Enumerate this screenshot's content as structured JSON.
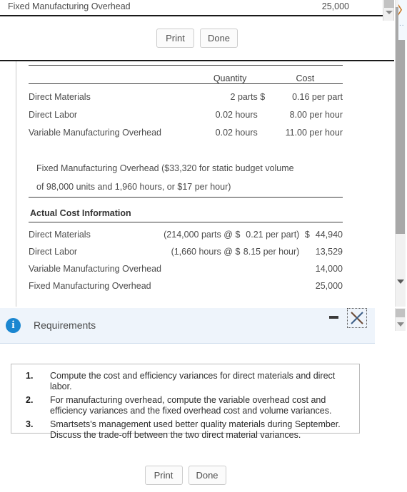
{
  "top_row": {
    "label": "Fixed Manufacturing Overhead",
    "value": "25,000"
  },
  "top_buttons": {
    "print_label": "Print",
    "done_label": "Done"
  },
  "standards_table": {
    "headers": [
      "",
      "Quantity",
      "",
      "Cost"
    ],
    "rows": [
      {
        "label": "Direct Materials",
        "quantity": "2 parts",
        "dollar": "$",
        "cost": "0.16 per part"
      },
      {
        "label": "Direct Labor",
        "quantity": "0.02 hours",
        "dollar": "",
        "cost": "8.00 per hour"
      },
      {
        "label": "Variable Manufacturing Overhead",
        "quantity": "0.02 hours",
        "dollar": "",
        "cost": "11.00 per hour"
      }
    ],
    "narrative_line_1": "Fixed Manufacturing Overhead ($33,320 for static budget volume",
    "narrative_line_2": "of 98,000 units and 1,960 hours, or $17 per hour)"
  },
  "actual_section": {
    "title": "Actual Cost Information",
    "rows": [
      {
        "label": "Direct Materials",
        "detail_qty": "(214,000 parts @",
        "dollar": "$",
        "detail_rate": "0.21 per part)",
        "dollar2": "$",
        "amount": "44,940"
      },
      {
        "label": "Direct Labor",
        "detail_qty": "(1,660 hours @",
        "dollar": "$",
        "detail_rate": "8.15 per hour)",
        "dollar2": "",
        "amount": "13,529"
      },
      {
        "label": "Variable Manufacturing Overhead",
        "detail_qty": "",
        "dollar": "",
        "detail_rate": "",
        "dollar2": "",
        "amount": "14,000"
      },
      {
        "label": "Fixed Manufacturing Overhead",
        "detail_qty": "",
        "dollar": "",
        "detail_rate": "",
        "dollar2": "",
        "amount": "25,000"
      }
    ]
  },
  "requirements_dialog": {
    "title": "Requirements",
    "info_glyph": "i",
    "items": [
      "Compute the cost and efficiency variances for direct materials and direct labor.",
      "For manufacturing overhead, compute the variable overhead cost and efficiency variances and the fixed overhead cost and volume variances.",
      "Smartsets's management used better quality materials during September. Discuss the trade-off between the two direct material variances."
    ],
    "print_label": "Print",
    "done_label": "Done"
  },
  "edge_widget": {
    "chevron": "〉",
    "dots": ".."
  },
  "colors": {
    "dialog_header_bg": "#eef4fb",
    "info_icon": "#1a86d0",
    "rule": "#3d3d3d",
    "text": "#4b4b4b",
    "chevron": "#c8741f"
  }
}
